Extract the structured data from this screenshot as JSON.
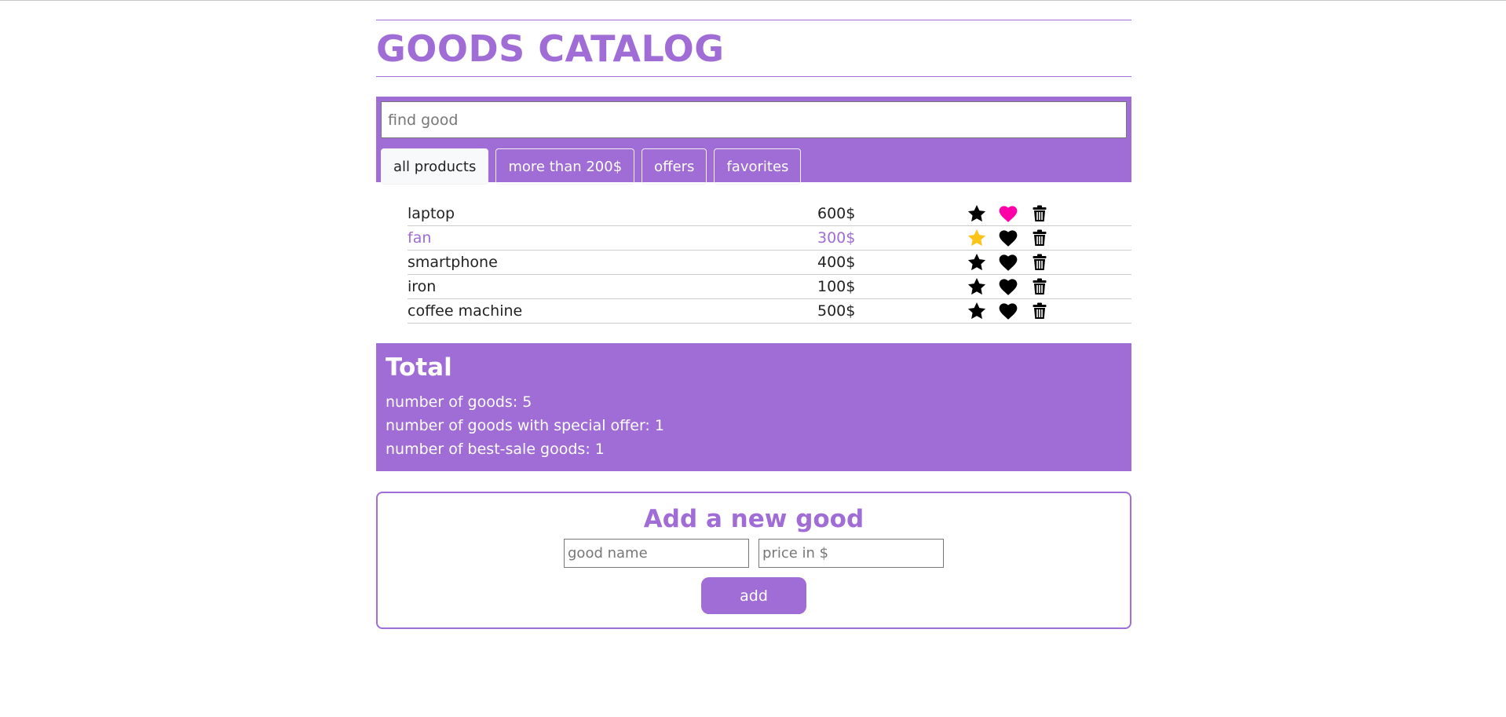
{
  "header": {
    "title": "GOODS CATALOG"
  },
  "search": {
    "placeholder": "find good",
    "value": ""
  },
  "filters": [
    {
      "label": "all products",
      "active": true
    },
    {
      "label": "more than 200$",
      "active": false
    },
    {
      "label": "offers",
      "active": false
    },
    {
      "label": "favorites",
      "active": false
    }
  ],
  "goods": [
    {
      "name": "laptop",
      "price": "600$",
      "offer": false,
      "favorite": true
    },
    {
      "name": "fan",
      "price": "300$",
      "offer": true,
      "favorite": false
    },
    {
      "name": "smartphone",
      "price": "400$",
      "offer": false,
      "favorite": false
    },
    {
      "name": "iron",
      "price": "100$",
      "offer": false,
      "favorite": false
    },
    {
      "name": "coffee machine",
      "price": "500$",
      "offer": false,
      "favorite": false
    }
  ],
  "total": {
    "title": "Total",
    "lines": [
      "number of goods: 5",
      "number of goods with special offer: 1",
      "number of best-sale goods: 1"
    ]
  },
  "add_form": {
    "title": "Add a new good",
    "name_placeholder": "good name",
    "price_placeholder": "price in $",
    "button_label": "add"
  },
  "colors": {
    "accent": "#a06cd5",
    "offer_star": "#fcc419",
    "favorite_heart": "#ff00a8",
    "default_icon": "#000000"
  },
  "icons": {
    "offer": "star-icon",
    "favorite": "heart-icon",
    "delete": "trash-icon"
  }
}
